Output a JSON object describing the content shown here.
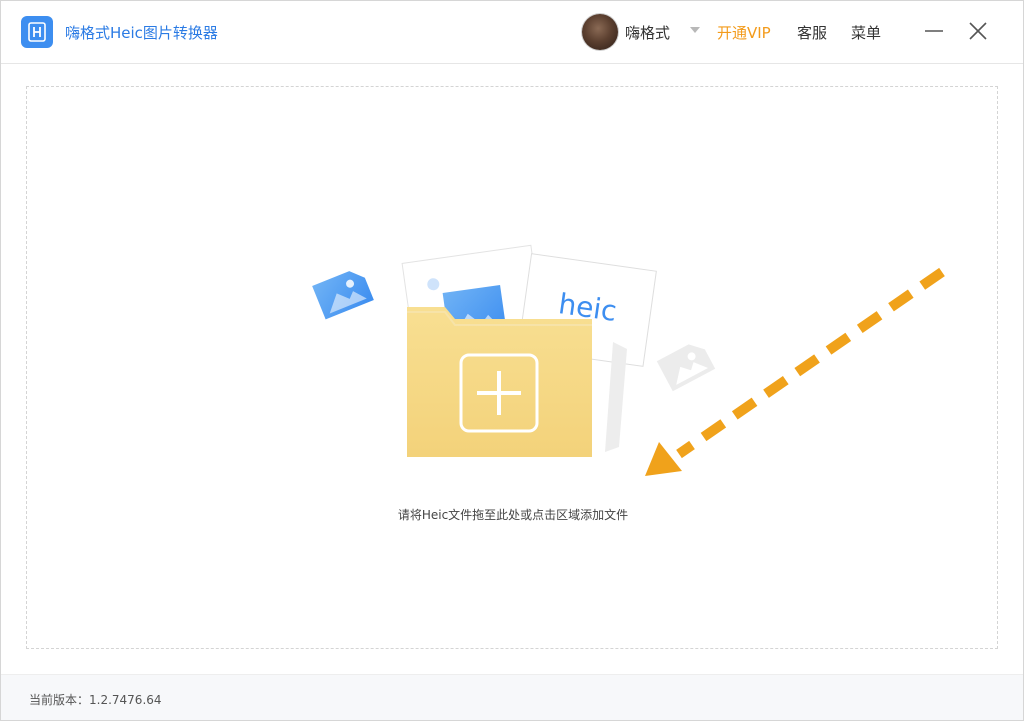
{
  "app": {
    "title": "嗨格式Heic图片转换器",
    "logo_icon": "app-logo-icon",
    "accent_color": "#3d8ef0"
  },
  "header": {
    "username": "嗨格式",
    "vip_label": "开通VIP",
    "vip_color": "#f39b1b",
    "service_label": "客服",
    "menu_label": "菜单"
  },
  "dropzone": {
    "hint": "请将Heic文件拖至此处或点击区域添加文件",
    "card_label": "heic",
    "folder_color": "#f6d987",
    "arrow_color": "#f0a21b"
  },
  "status": {
    "version_text": "当前版本：1.2.7476.64"
  }
}
